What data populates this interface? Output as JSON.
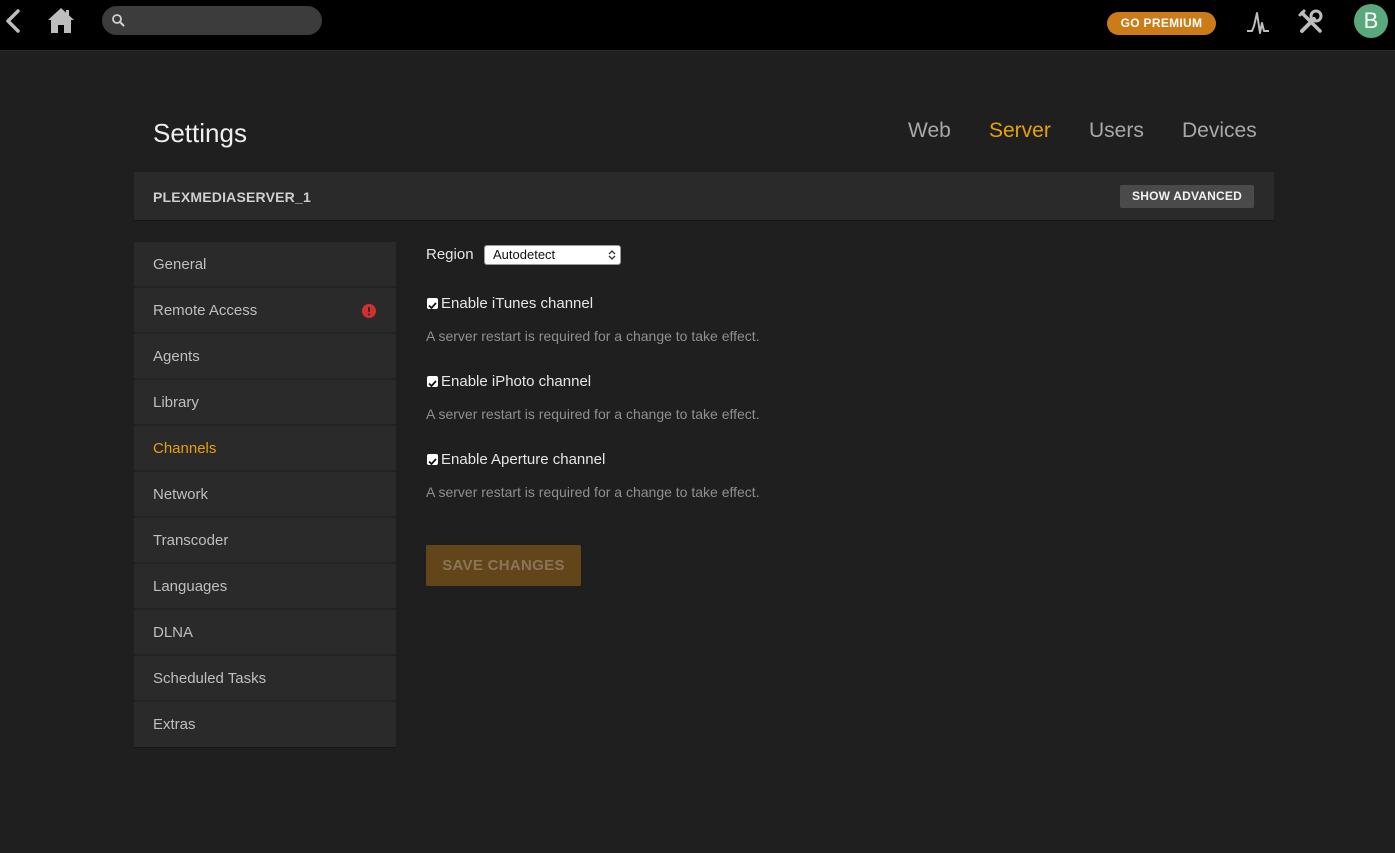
{
  "topbar": {
    "search": {
      "placeholder": "",
      "value": ""
    },
    "premium_label": "GO PREMIUM",
    "avatar_initial": "B"
  },
  "page": {
    "title": "Settings",
    "tabs": [
      {
        "label": "Web",
        "active": false
      },
      {
        "label": "Server",
        "active": true
      },
      {
        "label": "Users",
        "active": false
      },
      {
        "label": "Devices",
        "active": false
      }
    ]
  },
  "server": {
    "name": "PLEXMEDIASERVER_1",
    "advanced_label": "SHOW ADVANCED"
  },
  "sidebar": {
    "items": [
      {
        "label": "General"
      },
      {
        "label": "Remote Access",
        "warning": true
      },
      {
        "label": "Agents"
      },
      {
        "label": "Library"
      },
      {
        "label": "Channels",
        "active": true
      },
      {
        "label": "Network"
      },
      {
        "label": "Transcoder"
      },
      {
        "label": "Languages"
      },
      {
        "label": "DLNA"
      },
      {
        "label": "Scheduled Tasks"
      },
      {
        "label": "Extras"
      }
    ]
  },
  "content": {
    "region_label": "Region",
    "region_value": "Autodetect",
    "options": [
      {
        "label": "Enable iTunes channel",
        "checked": true,
        "help": "A server restart is required for a change to take effect."
      },
      {
        "label": "Enable iPhoto channel",
        "checked": true,
        "help": "A server restart is required for a change to take effect."
      },
      {
        "label": "Enable Aperture channel",
        "checked": true,
        "help": "A server restart is required for a change to take effect."
      }
    ],
    "save_label": "SAVE CHANGES"
  },
  "colors": {
    "accent": "#e5a00d",
    "premium": "#cc7b19",
    "avatar": "#5aa97c",
    "warning": "#d32f2f",
    "background": "#1f1f1f",
    "panel": "#2a2a2a"
  },
  "icons": {
    "back": "chevron-left-icon",
    "home": "home-icon",
    "search": "search-icon",
    "activity": "activity-icon",
    "tools": "tools-icon",
    "warning": "warning-icon",
    "select": "select-arrows-icon",
    "checkbox": "checkmark-icon"
  }
}
